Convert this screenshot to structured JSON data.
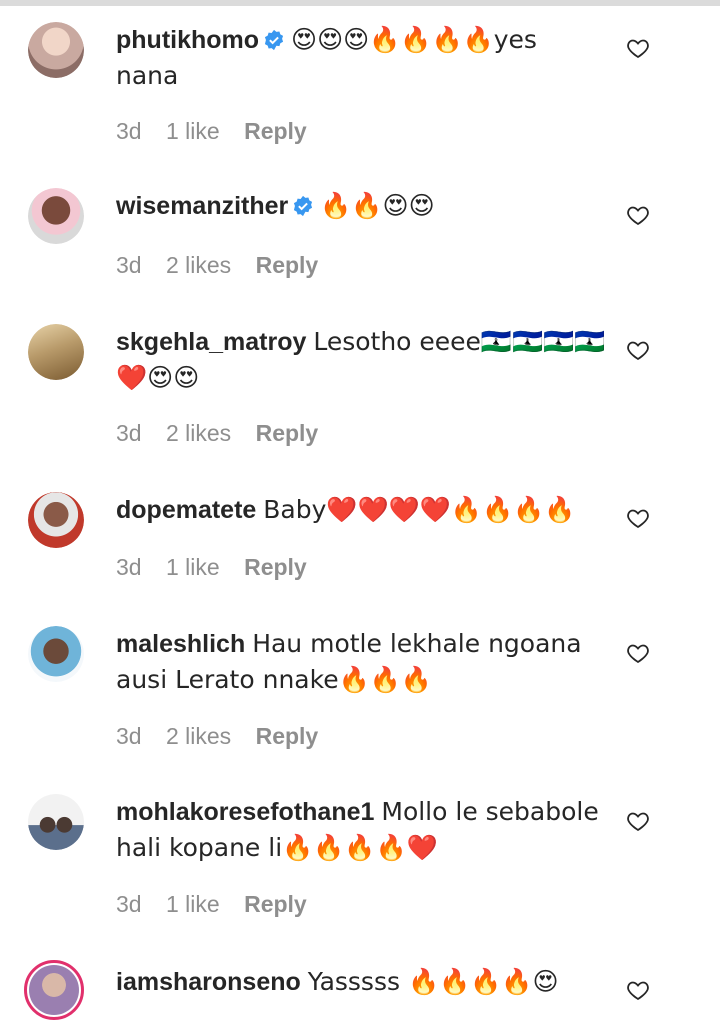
{
  "comments": [
    {
      "username": "phutikhomo",
      "verified": true,
      "text": "😍😍😍🔥🔥🔥🔥yes nana",
      "time": "3d",
      "likes": "1 like",
      "reply": "Reply",
      "avatar_color": "#c9a9a0"
    },
    {
      "username": "wisemanzither",
      "verified": true,
      "text": "🔥🔥😍😍",
      "time": "3d",
      "likes": "2 likes",
      "reply": "Reply",
      "avatar_color": "#7a4a3c"
    },
    {
      "username": "skgehla_matroy",
      "verified": false,
      "text": "Lesotho eeee🇱🇸🇱🇸🇱🇸🇱🇸❤️😍😍",
      "time": "3d",
      "likes": "2 likes",
      "reply": "Reply",
      "avatar_color": "#b89a6a"
    },
    {
      "username": "dopematete",
      "verified": false,
      "text": "Baby❤️❤️❤️❤️🔥🔥🔥🔥",
      "time": "3d",
      "likes": "1 like",
      "reply": "Reply",
      "avatar_color": "#c0392b"
    },
    {
      "username": "maleshlich",
      "verified": false,
      "text": "Hau motle lekhale ngoana ausi Lerato nnake🔥🔥🔥",
      "time": "3d",
      "likes": "2 likes",
      "reply": "Reply",
      "avatar_color": "#6fb4d9"
    },
    {
      "username": "mohlakoresefothane1",
      "verified": false,
      "text": "Mollo le sebabole hali kopane li🔥🔥🔥🔥❤️",
      "time": "3d",
      "likes": "1 like",
      "reply": "Reply",
      "avatar_color": "#5b6f8c"
    },
    {
      "username": "iamsharonseno",
      "verified": false,
      "text": "Yasssss 🔥🔥🔥🔥😍",
      "time": "",
      "likes": "",
      "reply": "",
      "avatar_color": "#9a7fb0"
    }
  ],
  "colors": {
    "text": "#262626",
    "meta": "#8e8e8e",
    "verified": "#3897f0",
    "story_ring": "#e1306c"
  },
  "icons": {
    "like": "heart-outline-icon",
    "verified": "verified-badge-icon"
  }
}
